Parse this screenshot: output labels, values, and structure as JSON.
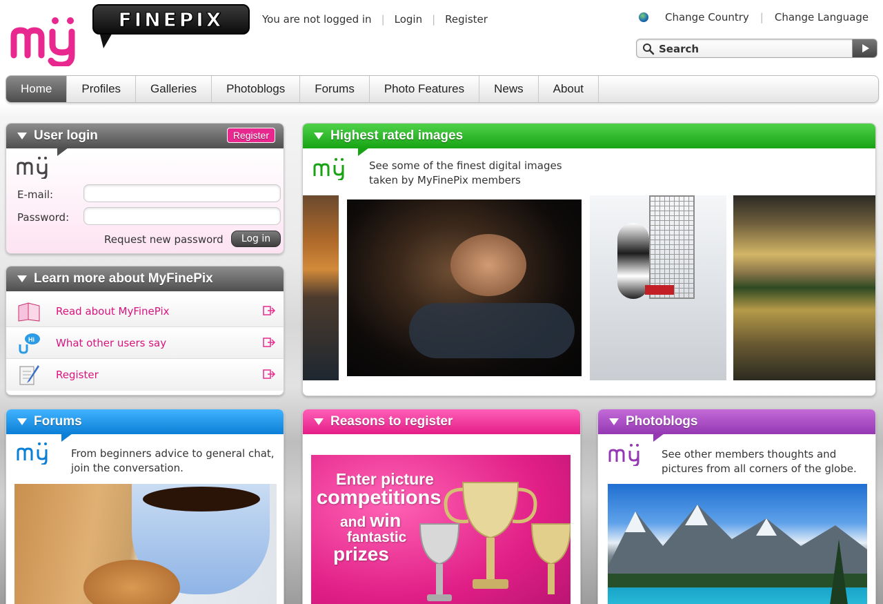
{
  "header": {
    "logo_text": "FINEPIX",
    "login_status": "You are not logged in",
    "login_link": "Login",
    "register_link": "Register",
    "change_country": "Change Country",
    "change_language": "Change Language",
    "search_label": "Search"
  },
  "nav": {
    "tabs": [
      {
        "label": "Home",
        "active": true
      },
      {
        "label": "Profiles"
      },
      {
        "label": "Galleries"
      },
      {
        "label": "Photoblogs"
      },
      {
        "label": "Forums"
      },
      {
        "label": "Photo Features"
      },
      {
        "label": "News"
      },
      {
        "label": "About"
      }
    ]
  },
  "login_panel": {
    "title": "User login",
    "register_button": "Register",
    "email_label": "E-mail:",
    "password_label": "Password:",
    "request_password": "Request new password",
    "login_button": "Log in"
  },
  "learn_panel": {
    "title": "Learn more about MyFinePix",
    "items": [
      {
        "label": "Read about MyFinePix",
        "icon": "book-icon"
      },
      {
        "label": "What other users say",
        "icon": "chat-icon"
      },
      {
        "label": "Register",
        "icon": "notepad-icon"
      }
    ]
  },
  "highest_panel": {
    "title": "Highest rated images",
    "text_line1": "See some of the finest digital images",
    "text_line2": "taken by MyFinePix members"
  },
  "forums_panel": {
    "title": "Forums",
    "text_line1": "From beginners advice to general chat,",
    "text_line2": "join the conversation."
  },
  "reasons_panel": {
    "title": "Reasons to register",
    "promo_line1": "Enter picture",
    "promo_line2": "competitions",
    "promo_and": "and",
    "promo_win": "win",
    "promo_line4": "fantastic",
    "promo_line5": "prizes"
  },
  "blogs_panel": {
    "title": "Photoblogs",
    "text_line1": "See other members thoughts and",
    "text_line2": "pictures from all corners of the globe."
  },
  "colors": {
    "brand_pink": "#e8288e",
    "green": "#17a314",
    "blue": "#0b7fd6",
    "purple": "#9538b3",
    "gray": "#4f4f4f"
  }
}
